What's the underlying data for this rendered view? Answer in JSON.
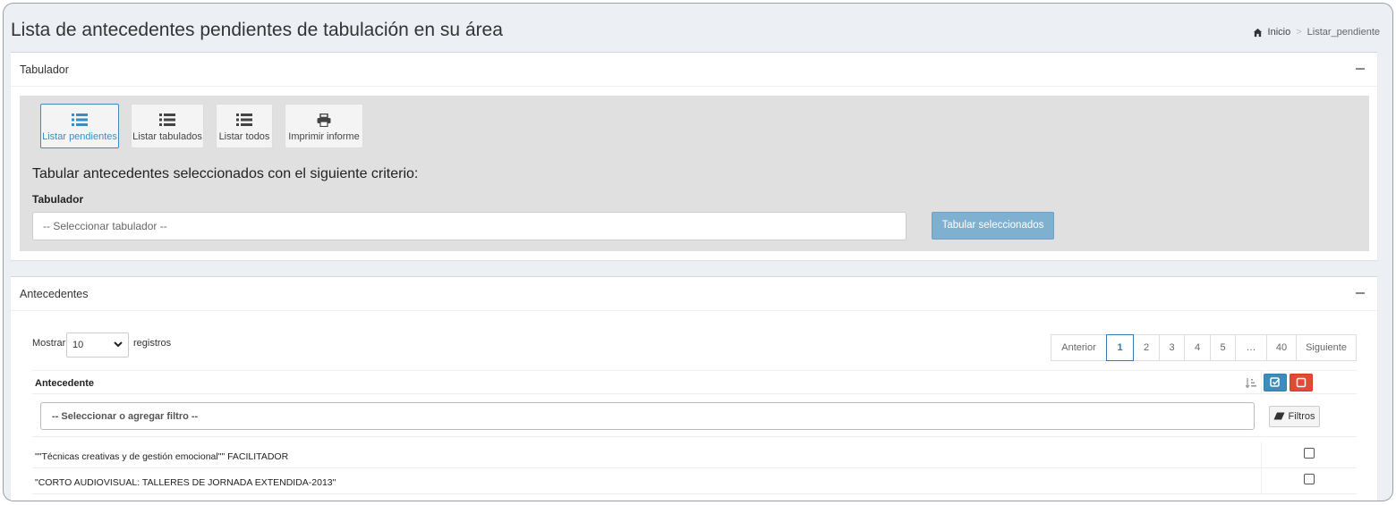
{
  "header": {
    "title": "Lista de antecedentes pendientes de tabulación en su área",
    "breadcrumb": {
      "home": "Inicio",
      "current": "Listar_pendiente"
    }
  },
  "tabulador_box": {
    "title": "Tabulador",
    "modes": [
      {
        "label": "Listar pendientes",
        "icon": "list-icon",
        "active": true
      },
      {
        "label": "Listar tabulados",
        "icon": "list-icon",
        "active": false
      },
      {
        "label": "Listar todos",
        "icon": "list-icon",
        "active": false
      },
      {
        "label": "Imprimir informe",
        "icon": "print-icon",
        "active": false
      }
    ],
    "criteria_text": "Tabular antecedentes seleccionados con el siguiente criterio:",
    "field_label": "Tabulador",
    "select_placeholder": "-- Seleccionar tabulador --",
    "submit_label": "Tabular seleccionados"
  },
  "antecedentes_box": {
    "title": "Antecedentes",
    "length": {
      "before": "Mostrar",
      "value": "10",
      "after": "registros"
    },
    "pagination": {
      "prev": "Anterior",
      "pages": [
        "1",
        "2",
        "3",
        "4",
        "5",
        "…",
        "40"
      ],
      "active_page": "1",
      "next": "Siguiente"
    },
    "table": {
      "column_header": "Antecedente",
      "filter_placeholder": "-- Seleccionar o agregar filtro --",
      "filter_button": "Filtros",
      "rows": [
        {
          "text": "\"\"Técnicas creativas y de gestión emocional\"\" FACILITADOR",
          "checked": false
        },
        {
          "text": "\"CORTO AUDIOVISUAL: TALLERES DE JORNADA EXTENDIDA-2013\"",
          "checked": false
        }
      ]
    }
  },
  "colors": {
    "primary": "#3c8dbc",
    "danger": "#dd4b39",
    "disabled_button": "#7fb0d0",
    "panel_bg": "#e0e0e0",
    "page_bg": "#ecf0f5"
  }
}
